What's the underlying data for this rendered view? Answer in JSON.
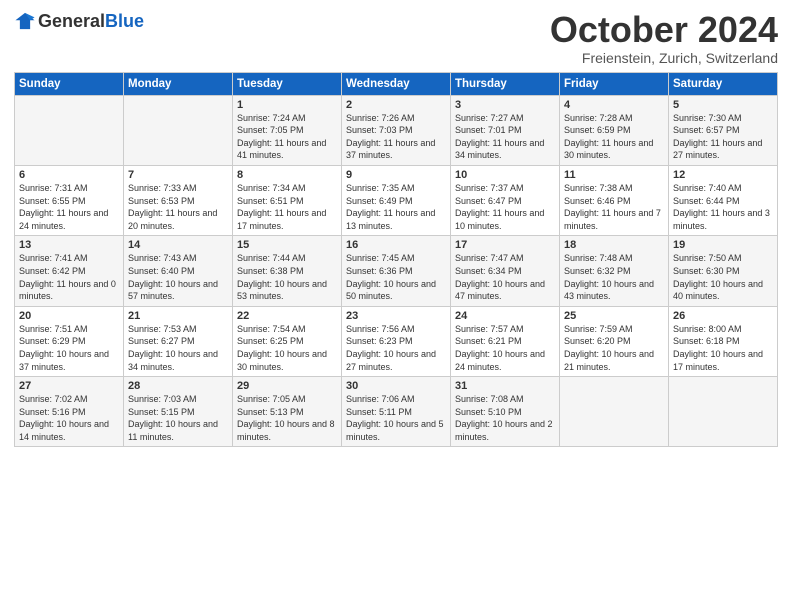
{
  "header": {
    "logo_general": "General",
    "logo_blue": "Blue",
    "month": "October 2024",
    "location": "Freienstein, Zurich, Switzerland"
  },
  "days_of_week": [
    "Sunday",
    "Monday",
    "Tuesday",
    "Wednesday",
    "Thursday",
    "Friday",
    "Saturday"
  ],
  "weeks": [
    [
      {
        "day": "",
        "info": ""
      },
      {
        "day": "",
        "info": ""
      },
      {
        "day": "1",
        "info": "Sunrise: 7:24 AM\nSunset: 7:05 PM\nDaylight: 11 hours and 41 minutes."
      },
      {
        "day": "2",
        "info": "Sunrise: 7:26 AM\nSunset: 7:03 PM\nDaylight: 11 hours and 37 minutes."
      },
      {
        "day": "3",
        "info": "Sunrise: 7:27 AM\nSunset: 7:01 PM\nDaylight: 11 hours and 34 minutes."
      },
      {
        "day": "4",
        "info": "Sunrise: 7:28 AM\nSunset: 6:59 PM\nDaylight: 11 hours and 30 minutes."
      },
      {
        "day": "5",
        "info": "Sunrise: 7:30 AM\nSunset: 6:57 PM\nDaylight: 11 hours and 27 minutes."
      }
    ],
    [
      {
        "day": "6",
        "info": "Sunrise: 7:31 AM\nSunset: 6:55 PM\nDaylight: 11 hours and 24 minutes."
      },
      {
        "day": "7",
        "info": "Sunrise: 7:33 AM\nSunset: 6:53 PM\nDaylight: 11 hours and 20 minutes."
      },
      {
        "day": "8",
        "info": "Sunrise: 7:34 AM\nSunset: 6:51 PM\nDaylight: 11 hours and 17 minutes."
      },
      {
        "day": "9",
        "info": "Sunrise: 7:35 AM\nSunset: 6:49 PM\nDaylight: 11 hours and 13 minutes."
      },
      {
        "day": "10",
        "info": "Sunrise: 7:37 AM\nSunset: 6:47 PM\nDaylight: 11 hours and 10 minutes."
      },
      {
        "day": "11",
        "info": "Sunrise: 7:38 AM\nSunset: 6:46 PM\nDaylight: 11 hours and 7 minutes."
      },
      {
        "day": "12",
        "info": "Sunrise: 7:40 AM\nSunset: 6:44 PM\nDaylight: 11 hours and 3 minutes."
      }
    ],
    [
      {
        "day": "13",
        "info": "Sunrise: 7:41 AM\nSunset: 6:42 PM\nDaylight: 11 hours and 0 minutes."
      },
      {
        "day": "14",
        "info": "Sunrise: 7:43 AM\nSunset: 6:40 PM\nDaylight: 10 hours and 57 minutes."
      },
      {
        "day": "15",
        "info": "Sunrise: 7:44 AM\nSunset: 6:38 PM\nDaylight: 10 hours and 53 minutes."
      },
      {
        "day": "16",
        "info": "Sunrise: 7:45 AM\nSunset: 6:36 PM\nDaylight: 10 hours and 50 minutes."
      },
      {
        "day": "17",
        "info": "Sunrise: 7:47 AM\nSunset: 6:34 PM\nDaylight: 10 hours and 47 minutes."
      },
      {
        "day": "18",
        "info": "Sunrise: 7:48 AM\nSunset: 6:32 PM\nDaylight: 10 hours and 43 minutes."
      },
      {
        "day": "19",
        "info": "Sunrise: 7:50 AM\nSunset: 6:30 PM\nDaylight: 10 hours and 40 minutes."
      }
    ],
    [
      {
        "day": "20",
        "info": "Sunrise: 7:51 AM\nSunset: 6:29 PM\nDaylight: 10 hours and 37 minutes."
      },
      {
        "day": "21",
        "info": "Sunrise: 7:53 AM\nSunset: 6:27 PM\nDaylight: 10 hours and 34 minutes."
      },
      {
        "day": "22",
        "info": "Sunrise: 7:54 AM\nSunset: 6:25 PM\nDaylight: 10 hours and 30 minutes."
      },
      {
        "day": "23",
        "info": "Sunrise: 7:56 AM\nSunset: 6:23 PM\nDaylight: 10 hours and 27 minutes."
      },
      {
        "day": "24",
        "info": "Sunrise: 7:57 AM\nSunset: 6:21 PM\nDaylight: 10 hours and 24 minutes."
      },
      {
        "day": "25",
        "info": "Sunrise: 7:59 AM\nSunset: 6:20 PM\nDaylight: 10 hours and 21 minutes."
      },
      {
        "day": "26",
        "info": "Sunrise: 8:00 AM\nSunset: 6:18 PM\nDaylight: 10 hours and 17 minutes."
      }
    ],
    [
      {
        "day": "27",
        "info": "Sunrise: 7:02 AM\nSunset: 5:16 PM\nDaylight: 10 hours and 14 minutes."
      },
      {
        "day": "28",
        "info": "Sunrise: 7:03 AM\nSunset: 5:15 PM\nDaylight: 10 hours and 11 minutes."
      },
      {
        "day": "29",
        "info": "Sunrise: 7:05 AM\nSunset: 5:13 PM\nDaylight: 10 hours and 8 minutes."
      },
      {
        "day": "30",
        "info": "Sunrise: 7:06 AM\nSunset: 5:11 PM\nDaylight: 10 hours and 5 minutes."
      },
      {
        "day": "31",
        "info": "Sunrise: 7:08 AM\nSunset: 5:10 PM\nDaylight: 10 hours and 2 minutes."
      },
      {
        "day": "",
        "info": ""
      },
      {
        "day": "",
        "info": ""
      }
    ]
  ]
}
